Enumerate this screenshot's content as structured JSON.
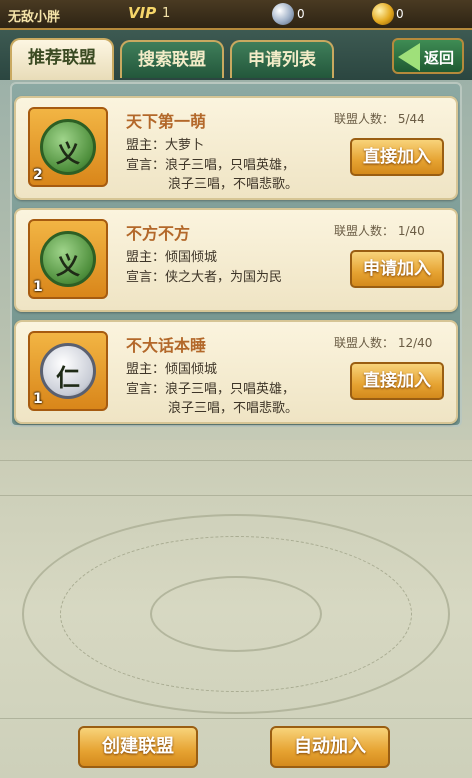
{
  "topbar": {
    "player_name": "无敌小胖",
    "vip_label": "VIP",
    "vip_level": "1",
    "silver_count": "0",
    "gold_count": "0"
  },
  "tabs": [
    {
      "label": "推荐联盟",
      "active": true
    },
    {
      "label": "搜索联盟",
      "active": false
    },
    {
      "label": "申请列表",
      "active": false
    }
  ],
  "back_label": "返回",
  "alliances": [
    {
      "name": "天下第一萌",
      "emblem": "义",
      "level": "2",
      "leader": "盟主：大萝卜",
      "motto_line1": "宣言：浪子三唱，只唱英雄，",
      "motto_line2": "浪子三唱，不唱悲歌。",
      "member_count": "联盟人数：  5/44",
      "action": "直接加入"
    },
    {
      "name": "不方不方",
      "emblem": "义",
      "level": "1",
      "leader": "盟主：倾国倾城",
      "motto_line1": "宣言：侠之大者，为国为民",
      "motto_line2": "",
      "member_count": "联盟人数：  1/40",
      "action": "申请加入"
    },
    {
      "name": "不大话本睡",
      "emblem": "仁",
      "level": "1",
      "leader": "盟主：倾国倾城",
      "motto_line1": "宣言：浪子三唱，只唱英雄，",
      "motto_line2": "浪子三唱，不唱悲歌。",
      "member_count": "联盟人数：  12/40",
      "action": "直接加入"
    }
  ],
  "bottom": {
    "create_label": "创建联盟",
    "auto_join_label": "自动加入"
  }
}
